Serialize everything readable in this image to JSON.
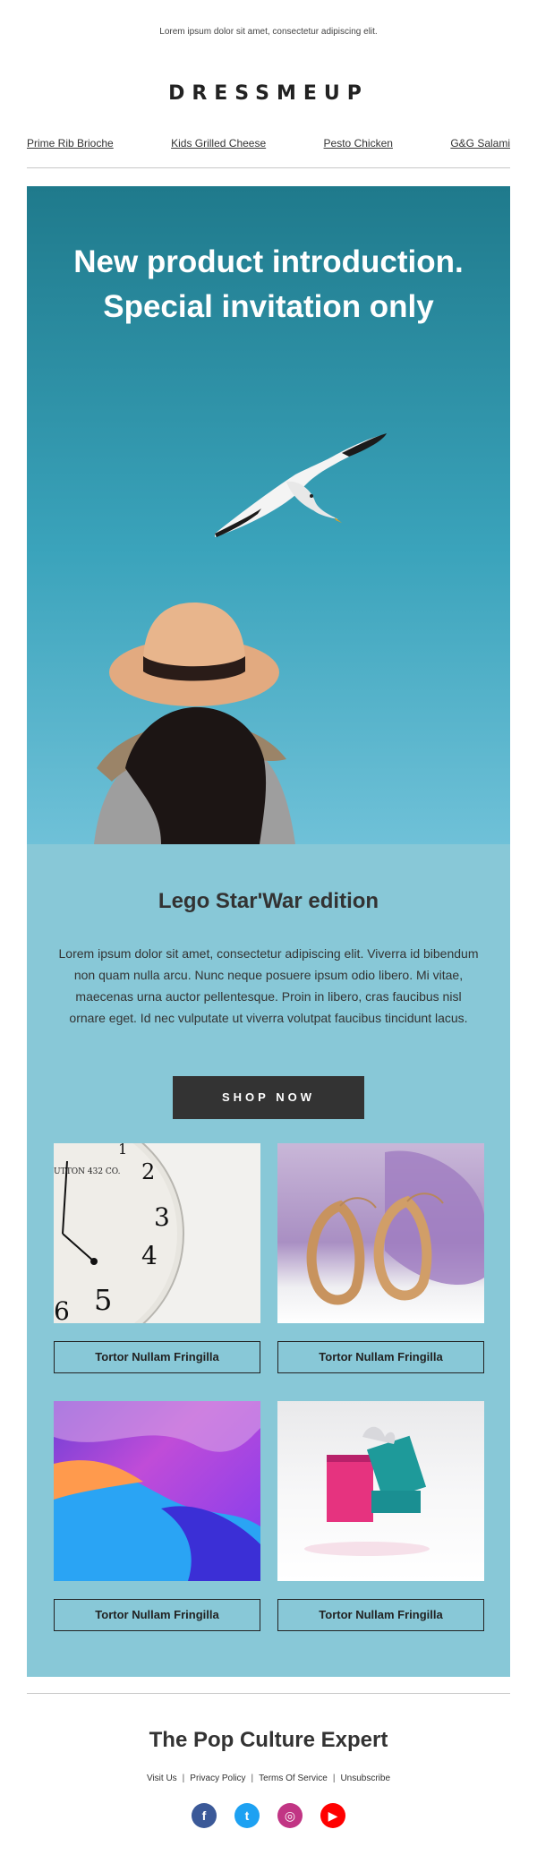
{
  "preheader": "Lorem ipsum dolor sit amet, consectetur adipiscing elit.",
  "brand": {
    "logo_text": "DRESSMEUP"
  },
  "nav": {
    "items": [
      {
        "label": "Prime Rib Brioche"
      },
      {
        "label": "Kids Grilled Cheese"
      },
      {
        "label": "Pesto Chicken"
      },
      {
        "label": "G&G Salami"
      }
    ]
  },
  "hero": {
    "title": "New product introduction. Special invitation only"
  },
  "promo": {
    "title": "Lego Star'War edition",
    "body": "Lorem ipsum dolor sit amet, consectetur adipiscing elit. Viverra id bibendum non quam nulla arcu. Nunc neque posuere ipsum odio libero. Mi vitae, maecenas urna auctor pellentesque. Proin in libero, cras faucibus nisl ornare eget. Id nec vulputate ut viverra volutpat faucibus tincidunt lacus.",
    "cta_label": "SHOP NOW"
  },
  "products": [
    {
      "label": "Tortor Nullam Fringilla",
      "image": "clock-image"
    },
    {
      "label": "Tortor Nullam Fringilla",
      "image": "earrings-image"
    },
    {
      "label": "Tortor Nullam Fringilla",
      "image": "abstract-gradient-image"
    },
    {
      "label": "Tortor Nullam Fringilla",
      "image": "gift-boxes-image"
    }
  ],
  "clock_text": "UTTON 432 CO.",
  "footer": {
    "title": "The Pop Culture Expert",
    "links": [
      "Visit Us",
      "Privacy Policy",
      "Terms Of Service",
      "Unsubscribe"
    ],
    "social": [
      {
        "name": "facebook-icon",
        "glyph": "f",
        "color": "#3b5998"
      },
      {
        "name": "twitter-icon",
        "glyph": "t",
        "color": "#1da1f2"
      },
      {
        "name": "instagram-icon",
        "glyph": "◎",
        "color": "#c13584"
      },
      {
        "name": "youtube-icon",
        "glyph": "▶",
        "color": "#ff0000"
      }
    ]
  },
  "colors": {
    "hero_top": "#1f7a8c",
    "promo_bg": "#88c8d7",
    "button_bg": "#333333"
  }
}
